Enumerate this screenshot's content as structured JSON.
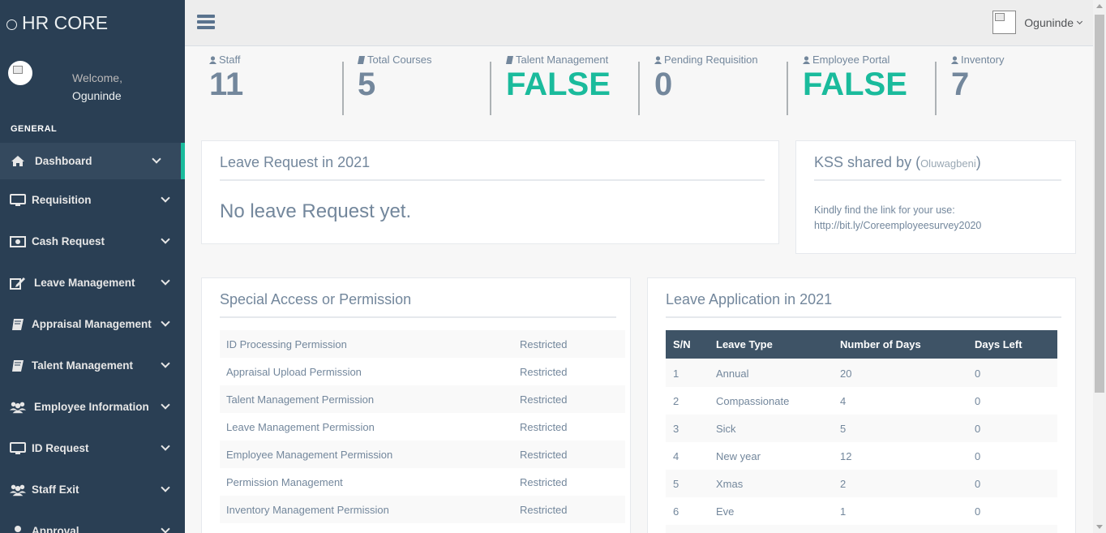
{
  "app": {
    "brand": "HR CORE"
  },
  "profile": {
    "welcome": "Welcome,",
    "name": "Oguninde"
  },
  "sidebar": {
    "section": "GENERAL",
    "items": [
      {
        "label": "Dashboard",
        "icon": "home-icon"
      },
      {
        "label": "Requisition",
        "icon": "desktop-icon"
      },
      {
        "label": "Cash Request",
        "icon": "money-icon"
      },
      {
        "label": "Leave Management",
        "icon": "edit-icon"
      },
      {
        "label": "Appraisal Management",
        "icon": "book-icon"
      },
      {
        "label": "Talent Management",
        "icon": "book-icon"
      },
      {
        "label": "Employee Information",
        "icon": "users-icon"
      },
      {
        "label": "ID Request",
        "icon": "desktop-icon"
      },
      {
        "label": "Staff Exit",
        "icon": "users-icon"
      },
      {
        "label": "Approval",
        "icon": "user-icon"
      }
    ]
  },
  "topnav": {
    "user": "Oguninde"
  },
  "tiles": [
    {
      "label": "Staff",
      "value": "11",
      "icon": "user-icon"
    },
    {
      "label": "Total Courses",
      "value": "5",
      "icon": "book-icon"
    },
    {
      "label": "Talent Management",
      "value": "FALSE",
      "icon": "book-icon"
    },
    {
      "label": "Pending Requisition",
      "value": "0",
      "icon": "user-icon"
    },
    {
      "label": "Employee Portal",
      "value": "FALSE",
      "icon": "user-icon"
    },
    {
      "label": "Inventory",
      "value": "7",
      "icon": "user-icon"
    }
  ],
  "leave_request": {
    "title": "Leave Request in 2021",
    "message": "No leave Request yet."
  },
  "kss": {
    "title_prefix": "KSS shared by (",
    "author": "Oluwagbeni",
    "title_suffix": ")",
    "line1": "Kindly find the link for your use:",
    "link": "http://bit.ly/Coreemployeesurvey2020"
  },
  "permissions": {
    "title": "Special Access or Permission",
    "rows": [
      {
        "name": "ID Processing Permission",
        "status": "Restricted"
      },
      {
        "name": "Appraisal Upload Permission",
        "status": "Restricted"
      },
      {
        "name": "Talent Management Permission",
        "status": "Restricted"
      },
      {
        "name": "Leave Management Permission",
        "status": "Restricted"
      },
      {
        "name": "Employee Management Permission",
        "status": "Restricted"
      },
      {
        "name": "Permission Management",
        "status": "Restricted"
      },
      {
        "name": "Inventory Management Permission",
        "status": "Restricted"
      }
    ]
  },
  "leave_app": {
    "title": "Leave Application in 2021",
    "columns": [
      "S/N",
      "Leave Type",
      "Number of Days",
      "Days Left"
    ],
    "rows": [
      [
        "1",
        "Annual",
        "20",
        "0"
      ],
      [
        "2",
        "Compassionate",
        "4",
        "0"
      ],
      [
        "3",
        "Sick",
        "5",
        "0"
      ],
      [
        "4",
        "New year",
        "12",
        "0"
      ],
      [
        "5",
        "Xmas",
        "2",
        "0"
      ],
      [
        "6",
        "Eve",
        "1",
        "0"
      ]
    ]
  },
  "colors": {
    "sidebar": "#2A3F54",
    "accent": "#1ABB9C",
    "text": "#73879C",
    "table_header": "#3E5366"
  }
}
